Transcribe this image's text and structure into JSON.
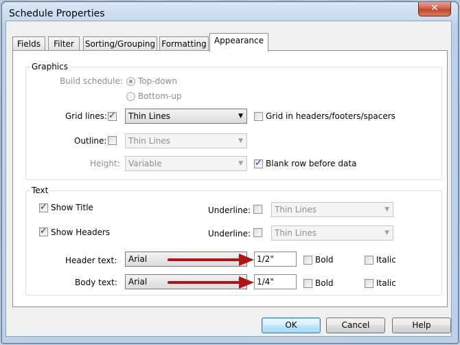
{
  "window": {
    "title": "Schedule Properties",
    "close_glyph": "✕"
  },
  "tabs": [
    {
      "label": "Fields"
    },
    {
      "label": "Filter"
    },
    {
      "label": "Sorting/Grouping"
    },
    {
      "label": "Formatting"
    },
    {
      "label": "Appearance",
      "active": true
    }
  ],
  "graphics": {
    "legend": "Graphics",
    "build_schedule_label": "Build schedule:",
    "top_down_label": "Top-down",
    "bottom_up_label": "Bottom-up",
    "grid_lines_label": "Grid lines:",
    "grid_lines_checked": true,
    "grid_lines_value": "Thin Lines",
    "grid_headers_label": "Grid in headers/footers/spacers",
    "grid_headers_checked": false,
    "outline_label": "Outline:",
    "outline_checked": false,
    "outline_value": "Thin Lines",
    "height_label": "Height:",
    "height_value": "Variable",
    "blank_row_label": "Blank row before data",
    "blank_row_checked": true
  },
  "text": {
    "legend": "Text",
    "show_title_label": "Show Title",
    "show_title_checked": true,
    "show_headers_label": "Show Headers",
    "show_headers_checked": true,
    "underline_label_1": "Underline:",
    "underline_value_1": "Thin Lines",
    "underline_label_2": "Underline:",
    "underline_value_2": "Thin Lines",
    "header_text_label": "Header text:",
    "header_font": "Arial",
    "header_size": "1/2\"",
    "body_text_label": "Body text:",
    "body_font": "Arial",
    "body_size": "1/4\"",
    "bold_label": "Bold",
    "italic_label": "Italic"
  },
  "buttons": {
    "ok": "OK",
    "cancel": "Cancel",
    "help": "Help"
  },
  "colors": {
    "annotation_arrow": "#b01515",
    "close_button": "#c9482f",
    "default_button_border": "#3c7fb1"
  },
  "icons": {
    "dropdown": "▼"
  }
}
